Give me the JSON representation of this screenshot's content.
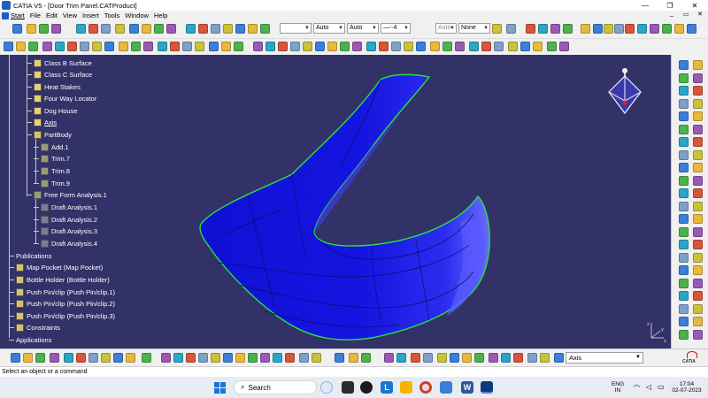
{
  "window": {
    "title": "CATIA V5 - [Door Trim Panel.CATProduct]",
    "minimize": "—",
    "restore": "❐",
    "close": "✕"
  },
  "menu": {
    "items": [
      "Start",
      "File",
      "Edit",
      "View",
      "Insert",
      "Tools",
      "Window",
      "Help"
    ],
    "doc_controls": [
      "_",
      "▭",
      "✕"
    ]
  },
  "toolbar": {
    "line_color": "",
    "line_thickness": "Auto",
    "line_type": "Auto",
    "line_weight": "4",
    "point_type": "Auto",
    "layer": "None"
  },
  "tree": {
    "nodes": [
      {
        "label": "Class B Surface",
        "underline": false
      },
      {
        "label": "Class C Surface",
        "underline": false
      },
      {
        "label": "Heat Stakes",
        "underline": false
      },
      {
        "label": "Four Way Locator",
        "underline": false
      },
      {
        "label": "Dog House",
        "underline": false
      },
      {
        "label": "Axis",
        "underline": true
      },
      {
        "label": "PartBody",
        "underline": false
      },
      {
        "label": "Add.1",
        "underline": false
      },
      {
        "label": "Trim.7",
        "underline": false
      },
      {
        "label": "Trim.8",
        "underline": false
      },
      {
        "label": "Trim.9",
        "underline": false
      },
      {
        "label": "Free Form Analysis.1",
        "underline": false
      },
      {
        "label": "Draft Analysis.1",
        "underline": false
      },
      {
        "label": "Draft Analysis.2",
        "underline": false
      },
      {
        "label": "Draft Analysis.3",
        "underline": false
      },
      {
        "label": "Draft Analysis.4",
        "underline": false
      },
      {
        "label": "Publications",
        "underline": false
      },
      {
        "label": "Map Pocket (Map Pocket)",
        "underline": false
      },
      {
        "label": "Bottle Holder (Bottle Holder)",
        "underline": false
      },
      {
        "label": "Push Pin/clip (Push Pin/clip.1)",
        "underline": false
      },
      {
        "label": "Push Pin/clip (Push Pin/clip.2)",
        "underline": false
      },
      {
        "label": "Push Pin/clip (Push Pin/clip.3)",
        "underline": false
      },
      {
        "label": "Constraints",
        "underline": false
      },
      {
        "label": "Applications",
        "underline": false
      }
    ]
  },
  "compass": {
    "z": "z",
    "x": "x",
    "y": "y"
  },
  "bottom_toolbar": {
    "axis_select": "Axis"
  },
  "status": {
    "prompt": "Select an object or a command"
  },
  "taskbar": {
    "search_placeholder": "Search",
    "language": "ENG",
    "region": "IN",
    "time": "17:04",
    "date": "02-07-2023"
  },
  "colors": {
    "viewport_bg": "#323269",
    "part_fill": "#1212d8",
    "part_edge": "#27e046"
  },
  "icons": [
    "catia-app-icon",
    "new-icon",
    "open-icon",
    "save-icon",
    "print-icon",
    "cut-icon",
    "copy-icon",
    "paste-icon",
    "undo-icon",
    "redo-icon",
    "help-icon",
    "fly-mode-icon",
    "fit-all-icon",
    "pan-icon",
    "rotate-icon",
    "zoom-in-icon",
    "zoom-out-icon",
    "normal-view-icon",
    "iso-view-icon",
    "shading-icon",
    "hide-show-icon",
    "swap-space-icon",
    "3d-compass-icon",
    "windows-start-icon",
    "search-icon",
    "wifi-icon",
    "speaker-icon",
    "battery-icon"
  ]
}
